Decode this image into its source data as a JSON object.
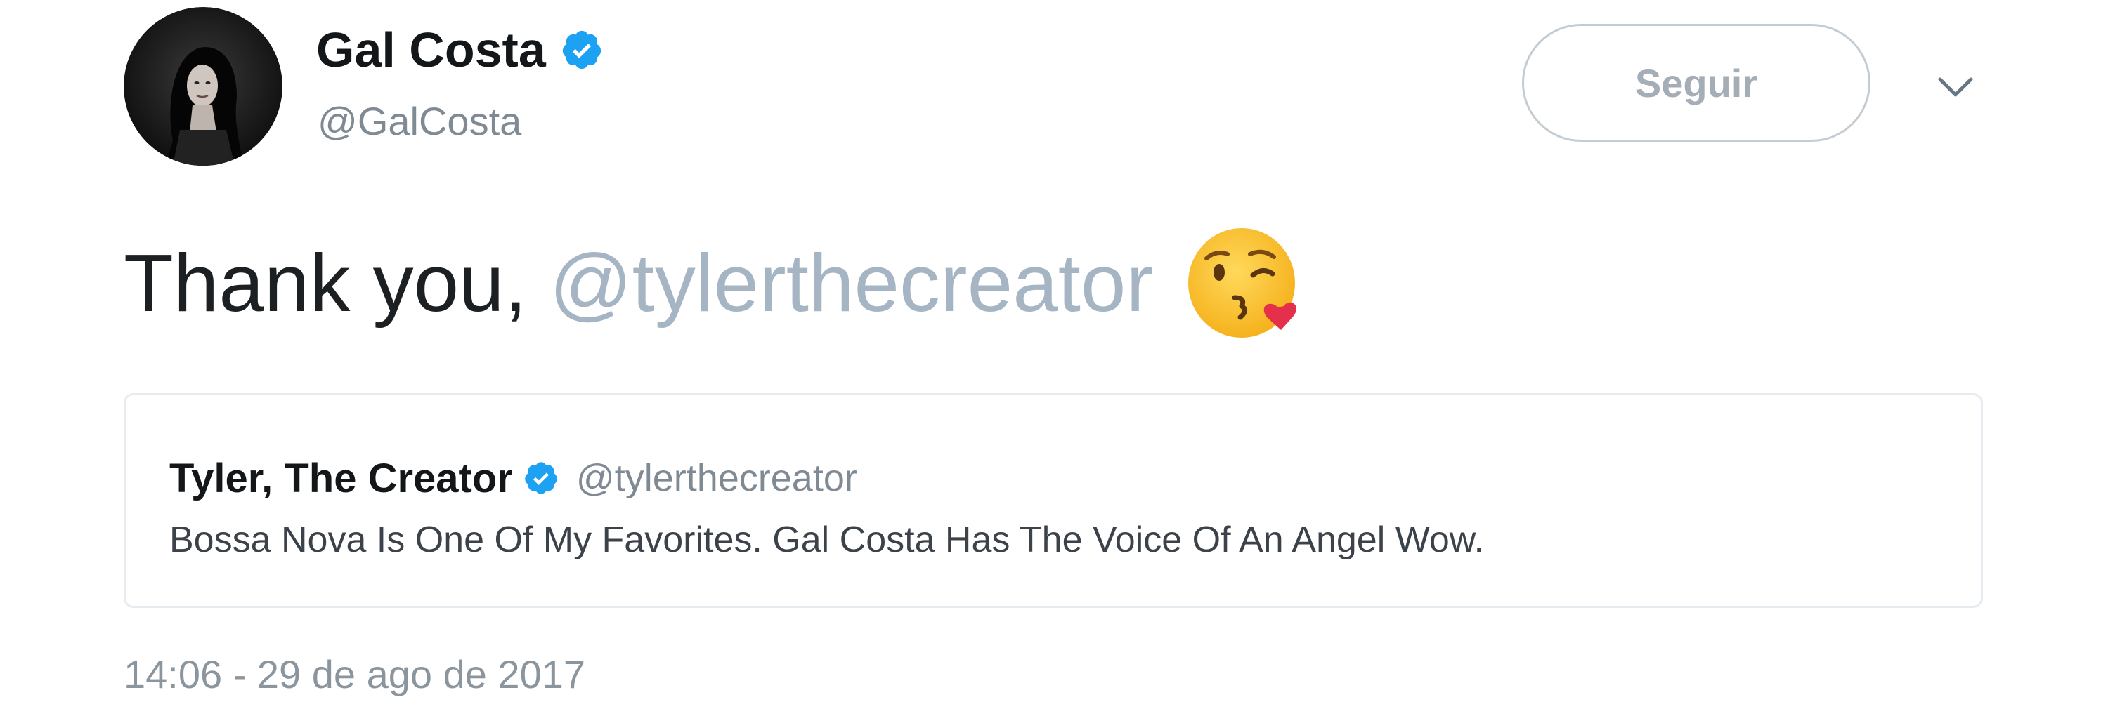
{
  "author": {
    "display_name": "Gal Costa",
    "handle": "@GalCosta",
    "verified": true,
    "avatar_icon": "profile-photo"
  },
  "actions": {
    "follow_label": "Seguir",
    "more_icon": "chevron-down-icon"
  },
  "tweet": {
    "text": "Thank you,",
    "mention": "@tylerthecreator",
    "emoji": "face-throwing-a-kiss"
  },
  "quoted_tweet": {
    "display_name": "Tyler, The Creator",
    "handle": "@tylerthecreator",
    "verified": true,
    "text": "Bossa Nova Is One Of My Favorites. Gal Costa Has The Voice Of An Angel Wow."
  },
  "timestamp": "14:06 - 29 de ago de 2017",
  "colors": {
    "verified_blue": "#1da1f2",
    "mention_gray": "#a6b5c3",
    "secondary_text": "#7f8a94",
    "border": "#e6ecf0"
  }
}
